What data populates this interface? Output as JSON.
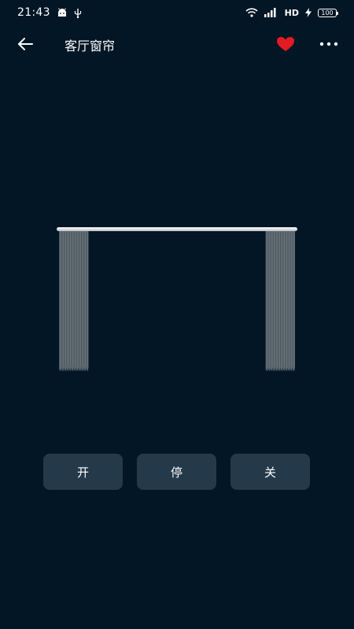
{
  "status_bar": {
    "time": "21:43",
    "network": "HD",
    "battery": "100"
  },
  "header": {
    "title": "客厅窗帘",
    "favorite_color": "#e31b23"
  },
  "curtain": {
    "open_fraction": 0.75
  },
  "controls": {
    "open_label": "开",
    "stop_label": "停",
    "close_label": "关"
  },
  "colors": {
    "background": "#021625",
    "button_bg": "#24394a",
    "curtain_fabric": "#59646c",
    "rod": "#e6e6e6"
  }
}
